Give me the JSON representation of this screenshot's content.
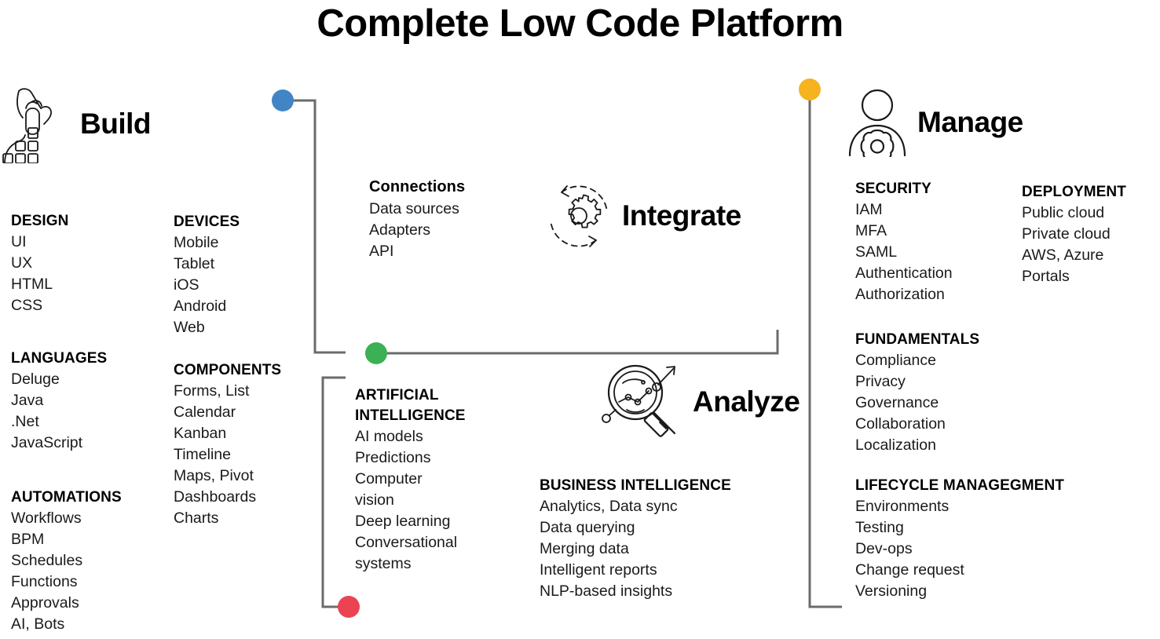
{
  "title": "Complete Low Code Platform",
  "colors": {
    "dot_blue": "#4285c4",
    "dot_green": "#3cb054",
    "dot_red": "#ea4martin",
    "dot_red_hex": "#ec4352",
    "dot_orange": "#f5b320",
    "connector_line": "#6b6b6b",
    "text": "#1a1a1a",
    "heading": "#000000"
  },
  "pillars": {
    "build": {
      "label": "Build",
      "icon": "hand-building-blocks-icon"
    },
    "integrate": {
      "label": "Integrate",
      "icon": "gear-refresh-icon"
    },
    "analyze": {
      "label": "Analyze",
      "icon": "magnifier-chart-icon"
    },
    "manage": {
      "label": "Manage",
      "icon": "person-gear-icon"
    }
  },
  "blocks": {
    "design": {
      "heading": "DESIGN",
      "items": [
        "UI",
        "UX",
        "HTML",
        "CSS"
      ]
    },
    "languages": {
      "heading": "LANGUAGES",
      "items": [
        "Deluge",
        "Java",
        ".Net",
        "JavaScript"
      ]
    },
    "automations": {
      "heading": "AUTOMATIONS",
      "items": [
        "Workflows",
        "BPM",
        "Schedules",
        "Functions",
        "Approvals",
        "AI, Bots"
      ]
    },
    "devices": {
      "heading": "DEVICES",
      "items": [
        "Mobile",
        "Tablet",
        "iOS",
        "Android",
        "Web"
      ]
    },
    "components": {
      "heading": "COMPONENTS",
      "items": [
        "Forms, List",
        "Calendar",
        "Kanban",
        "Timeline",
        "Maps, Pivot",
        "Dashboards",
        "Charts"
      ]
    },
    "connections": {
      "heading": "Connections",
      "items": [
        "Data sources",
        "Adapters",
        "API"
      ]
    },
    "ai": {
      "heading": "ARTIFICIAL\nINTELLIGENCE",
      "items": [
        "AI models",
        "Predictions",
        "Computer",
        "vision",
        "Deep learning",
        "Conversational",
        "systems"
      ]
    },
    "bi": {
      "heading": "BUSINESS INTELLIGENCE",
      "items": [
        "Analytics, Data sync",
        "Data querying",
        "Merging data",
        "Intelligent reports",
        "NLP-based insights"
      ]
    },
    "security": {
      "heading": "SECURITY",
      "items": [
        "IAM",
        "MFA",
        "SAML",
        "Authentication",
        "Authorization"
      ]
    },
    "deployment": {
      "heading": "DEPLOYMENT",
      "items": [
        "Public cloud",
        "Private cloud",
        "AWS, Azure",
        "Portals"
      ]
    },
    "fundamentals": {
      "heading": "FUNDAMENTALS",
      "items": [
        "Compliance",
        "Privacy",
        "Governance",
        "Collaboration",
        "Localization"
      ]
    },
    "lifecycle": {
      "heading": "LIFECYCLE MANAGEGMENT",
      "items": [
        "Environments",
        "Testing",
        "Dev-ops",
        "Change request",
        "Versioning"
      ]
    }
  },
  "connectors": {
    "blue_dot": {
      "name": "blue-node",
      "color": "#4285c4"
    },
    "green_dot": {
      "name": "green-node",
      "color": "#3cb054"
    },
    "red_dot": {
      "name": "red-node",
      "color": "#ec4352"
    },
    "orange_dot": {
      "name": "orange-node",
      "color": "#f5b320"
    }
  }
}
